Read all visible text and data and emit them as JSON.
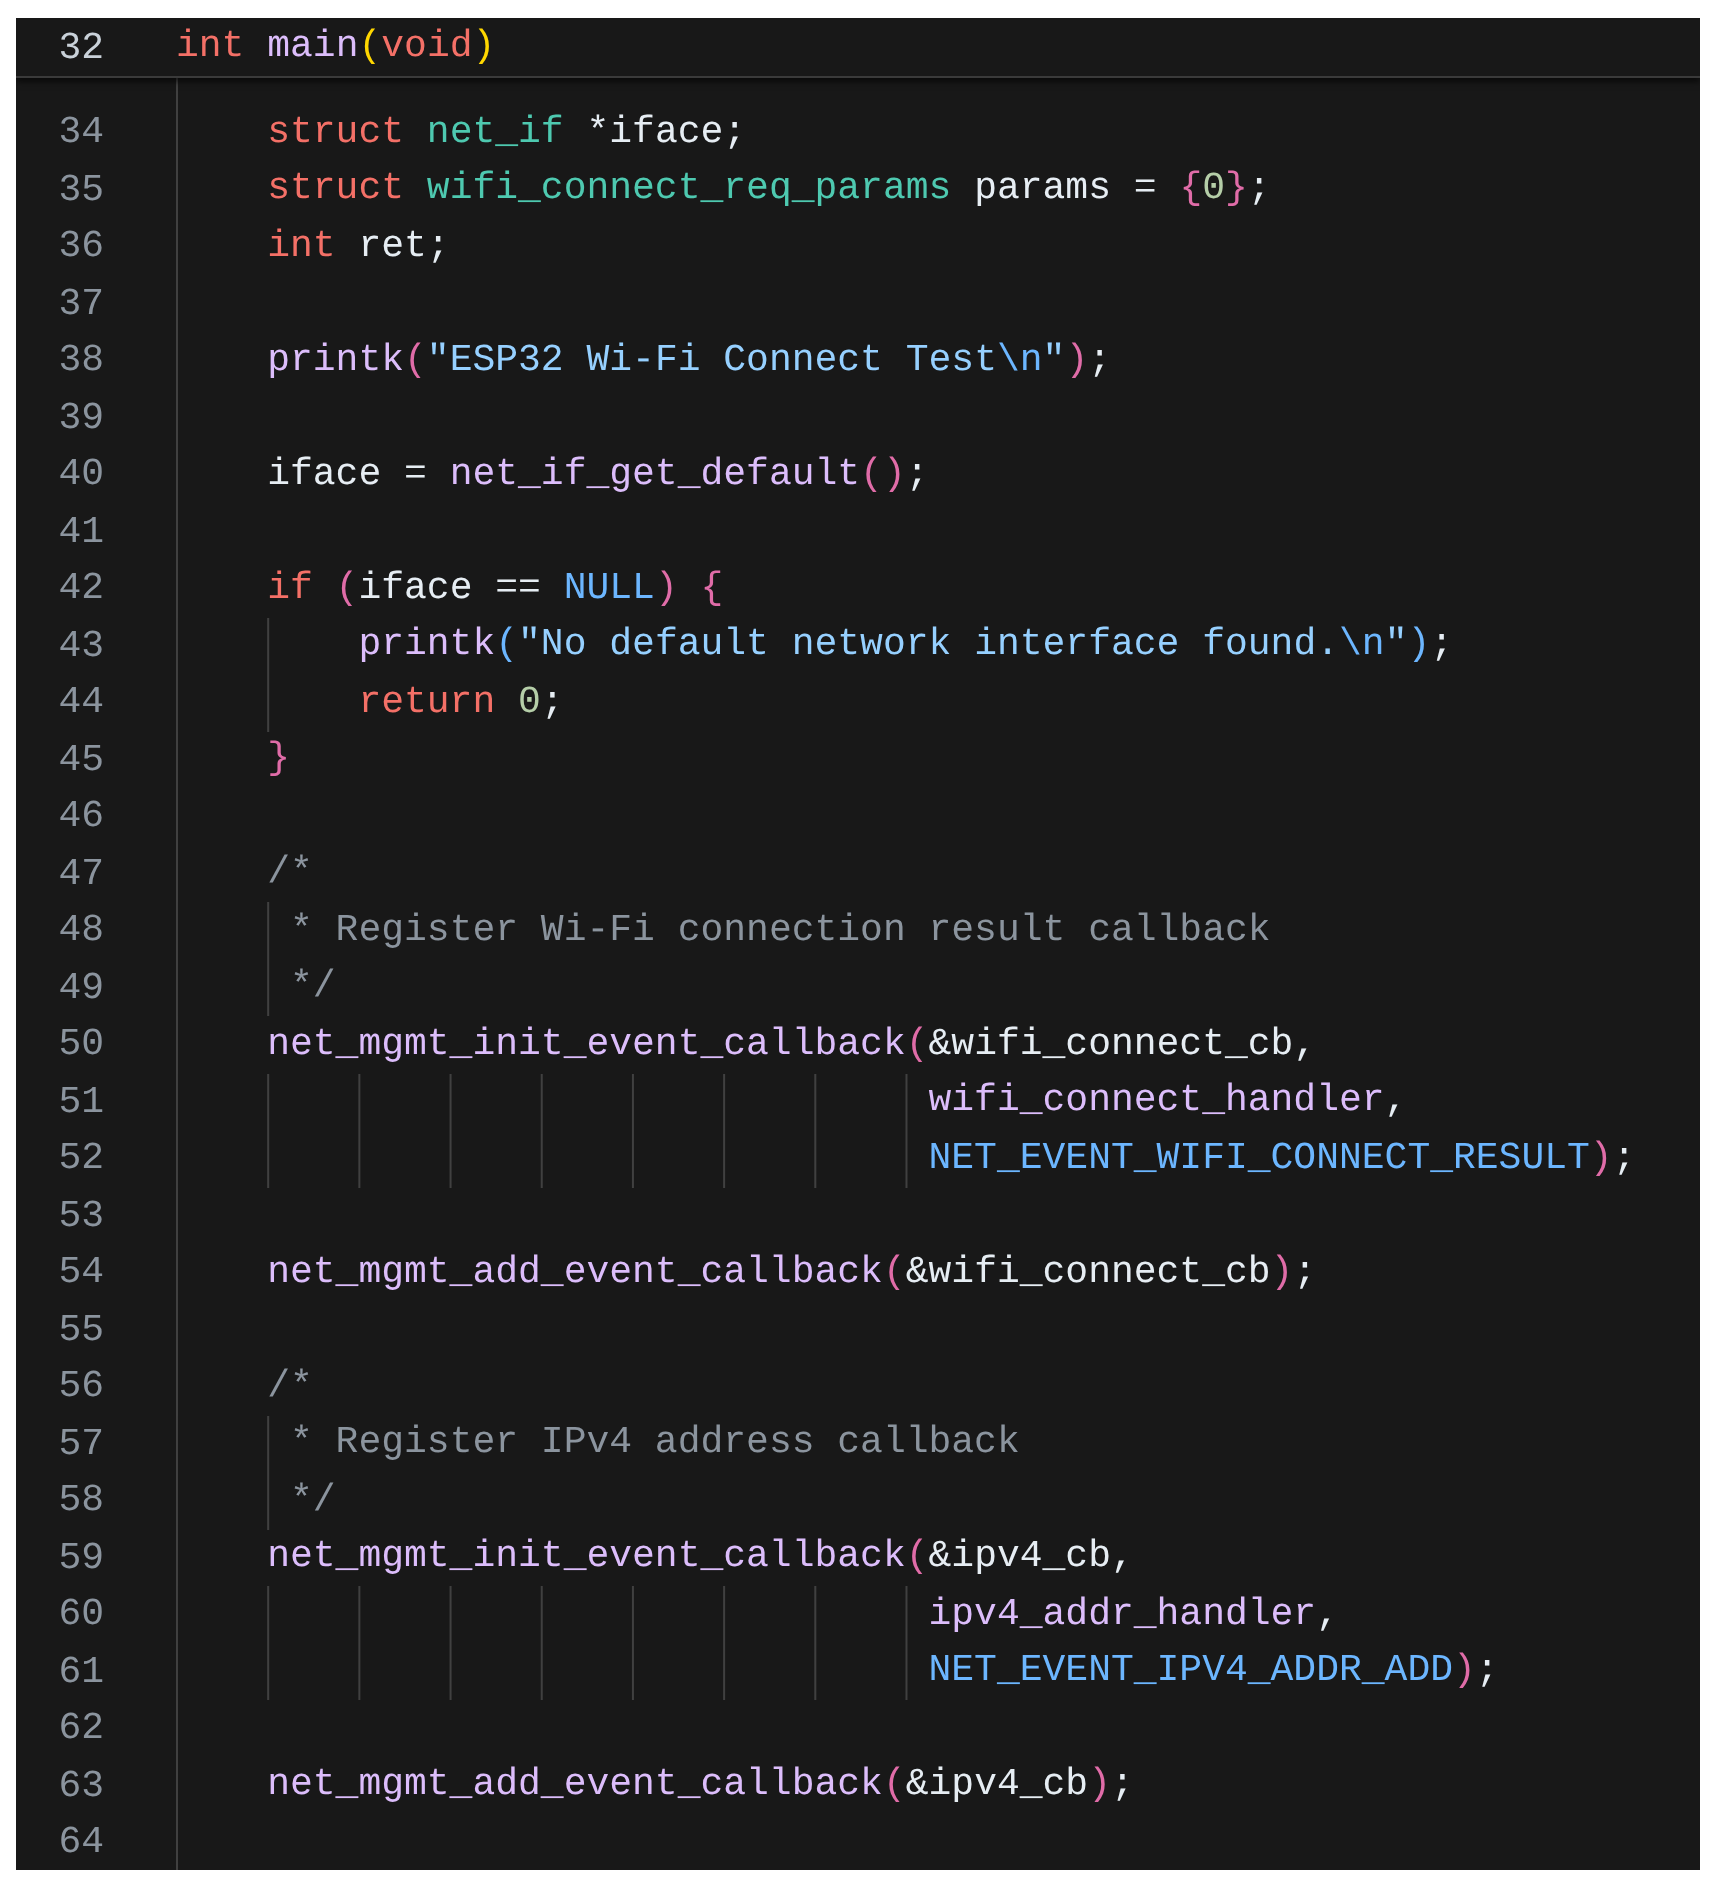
{
  "sticky_line": {
    "number": "32",
    "tokens": [
      {
        "kind": "keyword",
        "text": "int"
      },
      {
        "kind": "function",
        "text": " main"
      },
      {
        "kind": "bracket1",
        "text": "("
      },
      {
        "kind": "keyword",
        "text": "void"
      },
      {
        "kind": "bracket1",
        "text": ")"
      }
    ]
  },
  "lines": [
    {
      "number": "34",
      "tokens": [
        {
          "kind": "keyword",
          "text": "    struct"
        },
        {
          "kind": "type",
          "text": " net_if"
        },
        {
          "kind": "plain",
          "text": " *iface;"
        }
      ]
    },
    {
      "number": "35",
      "tokens": [
        {
          "kind": "keyword",
          "text": "    struct"
        },
        {
          "kind": "type",
          "text": " wifi_connect_req_params"
        },
        {
          "kind": "plain",
          "text": " params = "
        },
        {
          "kind": "bracket2",
          "text": "{"
        },
        {
          "kind": "number",
          "text": "0"
        },
        {
          "kind": "bracket2",
          "text": "}"
        },
        {
          "kind": "plain",
          "text": ";"
        }
      ]
    },
    {
      "number": "36",
      "tokens": [
        {
          "kind": "keyword",
          "text": "    int"
        },
        {
          "kind": "plain",
          "text": " ret;"
        }
      ]
    },
    {
      "number": "37"
    },
    {
      "number": "38",
      "tokens": [
        {
          "kind": "function",
          "text": "    printk"
        },
        {
          "kind": "bracket2",
          "text": "("
        },
        {
          "kind": "string",
          "text": "\"ESP32 Wi-Fi Connect Test"
        },
        {
          "kind": "escape",
          "text": "\\n"
        },
        {
          "kind": "string",
          "text": "\""
        },
        {
          "kind": "bracket2",
          "text": ")"
        },
        {
          "kind": "plain",
          "text": ";"
        }
      ]
    },
    {
      "number": "39"
    },
    {
      "number": "40",
      "tokens": [
        {
          "kind": "plain",
          "text": "    iface = "
        },
        {
          "kind": "function",
          "text": "net_if_get_default"
        },
        {
          "kind": "bracket2",
          "text": "()"
        },
        {
          "kind": "plain",
          "text": ";"
        }
      ]
    },
    {
      "number": "41"
    },
    {
      "number": "42",
      "tokens": [
        {
          "kind": "keyword",
          "text": "    if"
        },
        {
          "kind": "bracket2",
          "text": " ("
        },
        {
          "kind": "plain",
          "text": "iface == "
        },
        {
          "kind": "macro",
          "text": "NULL"
        },
        {
          "kind": "bracket2",
          "text": ")"
        },
        {
          "kind": "bracket2",
          "text": " {"
        }
      ]
    },
    {
      "number": "43",
      "tokens": [
        {
          "kind": "function",
          "text": "        printk"
        },
        {
          "kind": "bracket3",
          "text": "("
        },
        {
          "kind": "string",
          "text": "\"No default network interface found."
        },
        {
          "kind": "escape",
          "text": "\\n"
        },
        {
          "kind": "string",
          "text": "\""
        },
        {
          "kind": "bracket3",
          "text": ")"
        },
        {
          "kind": "plain",
          "text": ";"
        }
      ]
    },
    {
      "number": "44",
      "tokens": [
        {
          "kind": "keyword",
          "text": "        return"
        },
        {
          "kind": "number",
          "text": " 0"
        },
        {
          "kind": "plain",
          "text": ";"
        }
      ]
    },
    {
      "number": "45",
      "tokens": [
        {
          "kind": "bracket2",
          "text": "    }"
        }
      ]
    },
    {
      "number": "46"
    },
    {
      "number": "47",
      "tokens": [
        {
          "kind": "comment",
          "text": "    /*"
        }
      ]
    },
    {
      "number": "48",
      "tokens": [
        {
          "kind": "comment",
          "text": "     * Register Wi-Fi connection result callback"
        }
      ]
    },
    {
      "number": "49",
      "tokens": [
        {
          "kind": "comment",
          "text": "     */"
        }
      ]
    },
    {
      "number": "50",
      "tokens": [
        {
          "kind": "function",
          "text": "    net_mgmt_init_event_callback"
        },
        {
          "kind": "bracket2",
          "text": "("
        },
        {
          "kind": "plain",
          "text": "&wifi_connect_cb,"
        }
      ]
    },
    {
      "number": "51",
      "tokens": [
        {
          "kind": "function",
          "text": "                                 wifi_connect_handler"
        },
        {
          "kind": "plain",
          "text": ","
        }
      ]
    },
    {
      "number": "52",
      "tokens": [
        {
          "kind": "macro",
          "text": "                                 NET_EVENT_WIFI_CONNECT_RESULT"
        },
        {
          "kind": "bracket2",
          "text": ")"
        },
        {
          "kind": "plain",
          "text": ";"
        }
      ]
    },
    {
      "number": "53"
    },
    {
      "number": "54",
      "tokens": [
        {
          "kind": "function",
          "text": "    net_mgmt_add_event_callback"
        },
        {
          "kind": "bracket2",
          "text": "("
        },
        {
          "kind": "plain",
          "text": "&wifi_connect_cb"
        },
        {
          "kind": "bracket2",
          "text": ")"
        },
        {
          "kind": "plain",
          "text": ";"
        }
      ]
    },
    {
      "number": "55"
    },
    {
      "number": "56",
      "tokens": [
        {
          "kind": "comment",
          "text": "    /*"
        }
      ]
    },
    {
      "number": "57",
      "tokens": [
        {
          "kind": "comment",
          "text": "     * Register IPv4 address callback"
        }
      ]
    },
    {
      "number": "58",
      "tokens": [
        {
          "kind": "comment",
          "text": "     */"
        }
      ]
    },
    {
      "number": "59",
      "tokens": [
        {
          "kind": "function",
          "text": "    net_mgmt_init_event_callback"
        },
        {
          "kind": "bracket2",
          "text": "("
        },
        {
          "kind": "plain",
          "text": "&ipv4_cb,"
        }
      ]
    },
    {
      "number": "60",
      "tokens": [
        {
          "kind": "function",
          "text": "                                 ipv4_addr_handler"
        },
        {
          "kind": "plain",
          "text": ","
        }
      ]
    },
    {
      "number": "61",
      "tokens": [
        {
          "kind": "macro",
          "text": "                                 NET_EVENT_IPV4_ADDR_ADD"
        },
        {
          "kind": "bracket2",
          "text": ")"
        },
        {
          "kind": "plain",
          "text": ";"
        }
      ]
    },
    {
      "number": "62"
    },
    {
      "number": "63",
      "tokens": [
        {
          "kind": "function",
          "text": "    net_mgmt_add_event_callback"
        },
        {
          "kind": "bracket2",
          "text": "("
        },
        {
          "kind": "plain",
          "text": "&ipv4_cb"
        },
        {
          "kind": "bracket2",
          "text": ")"
        },
        {
          "kind": "plain",
          "text": ";"
        }
      ]
    },
    {
      "number": "64"
    }
  ]
}
